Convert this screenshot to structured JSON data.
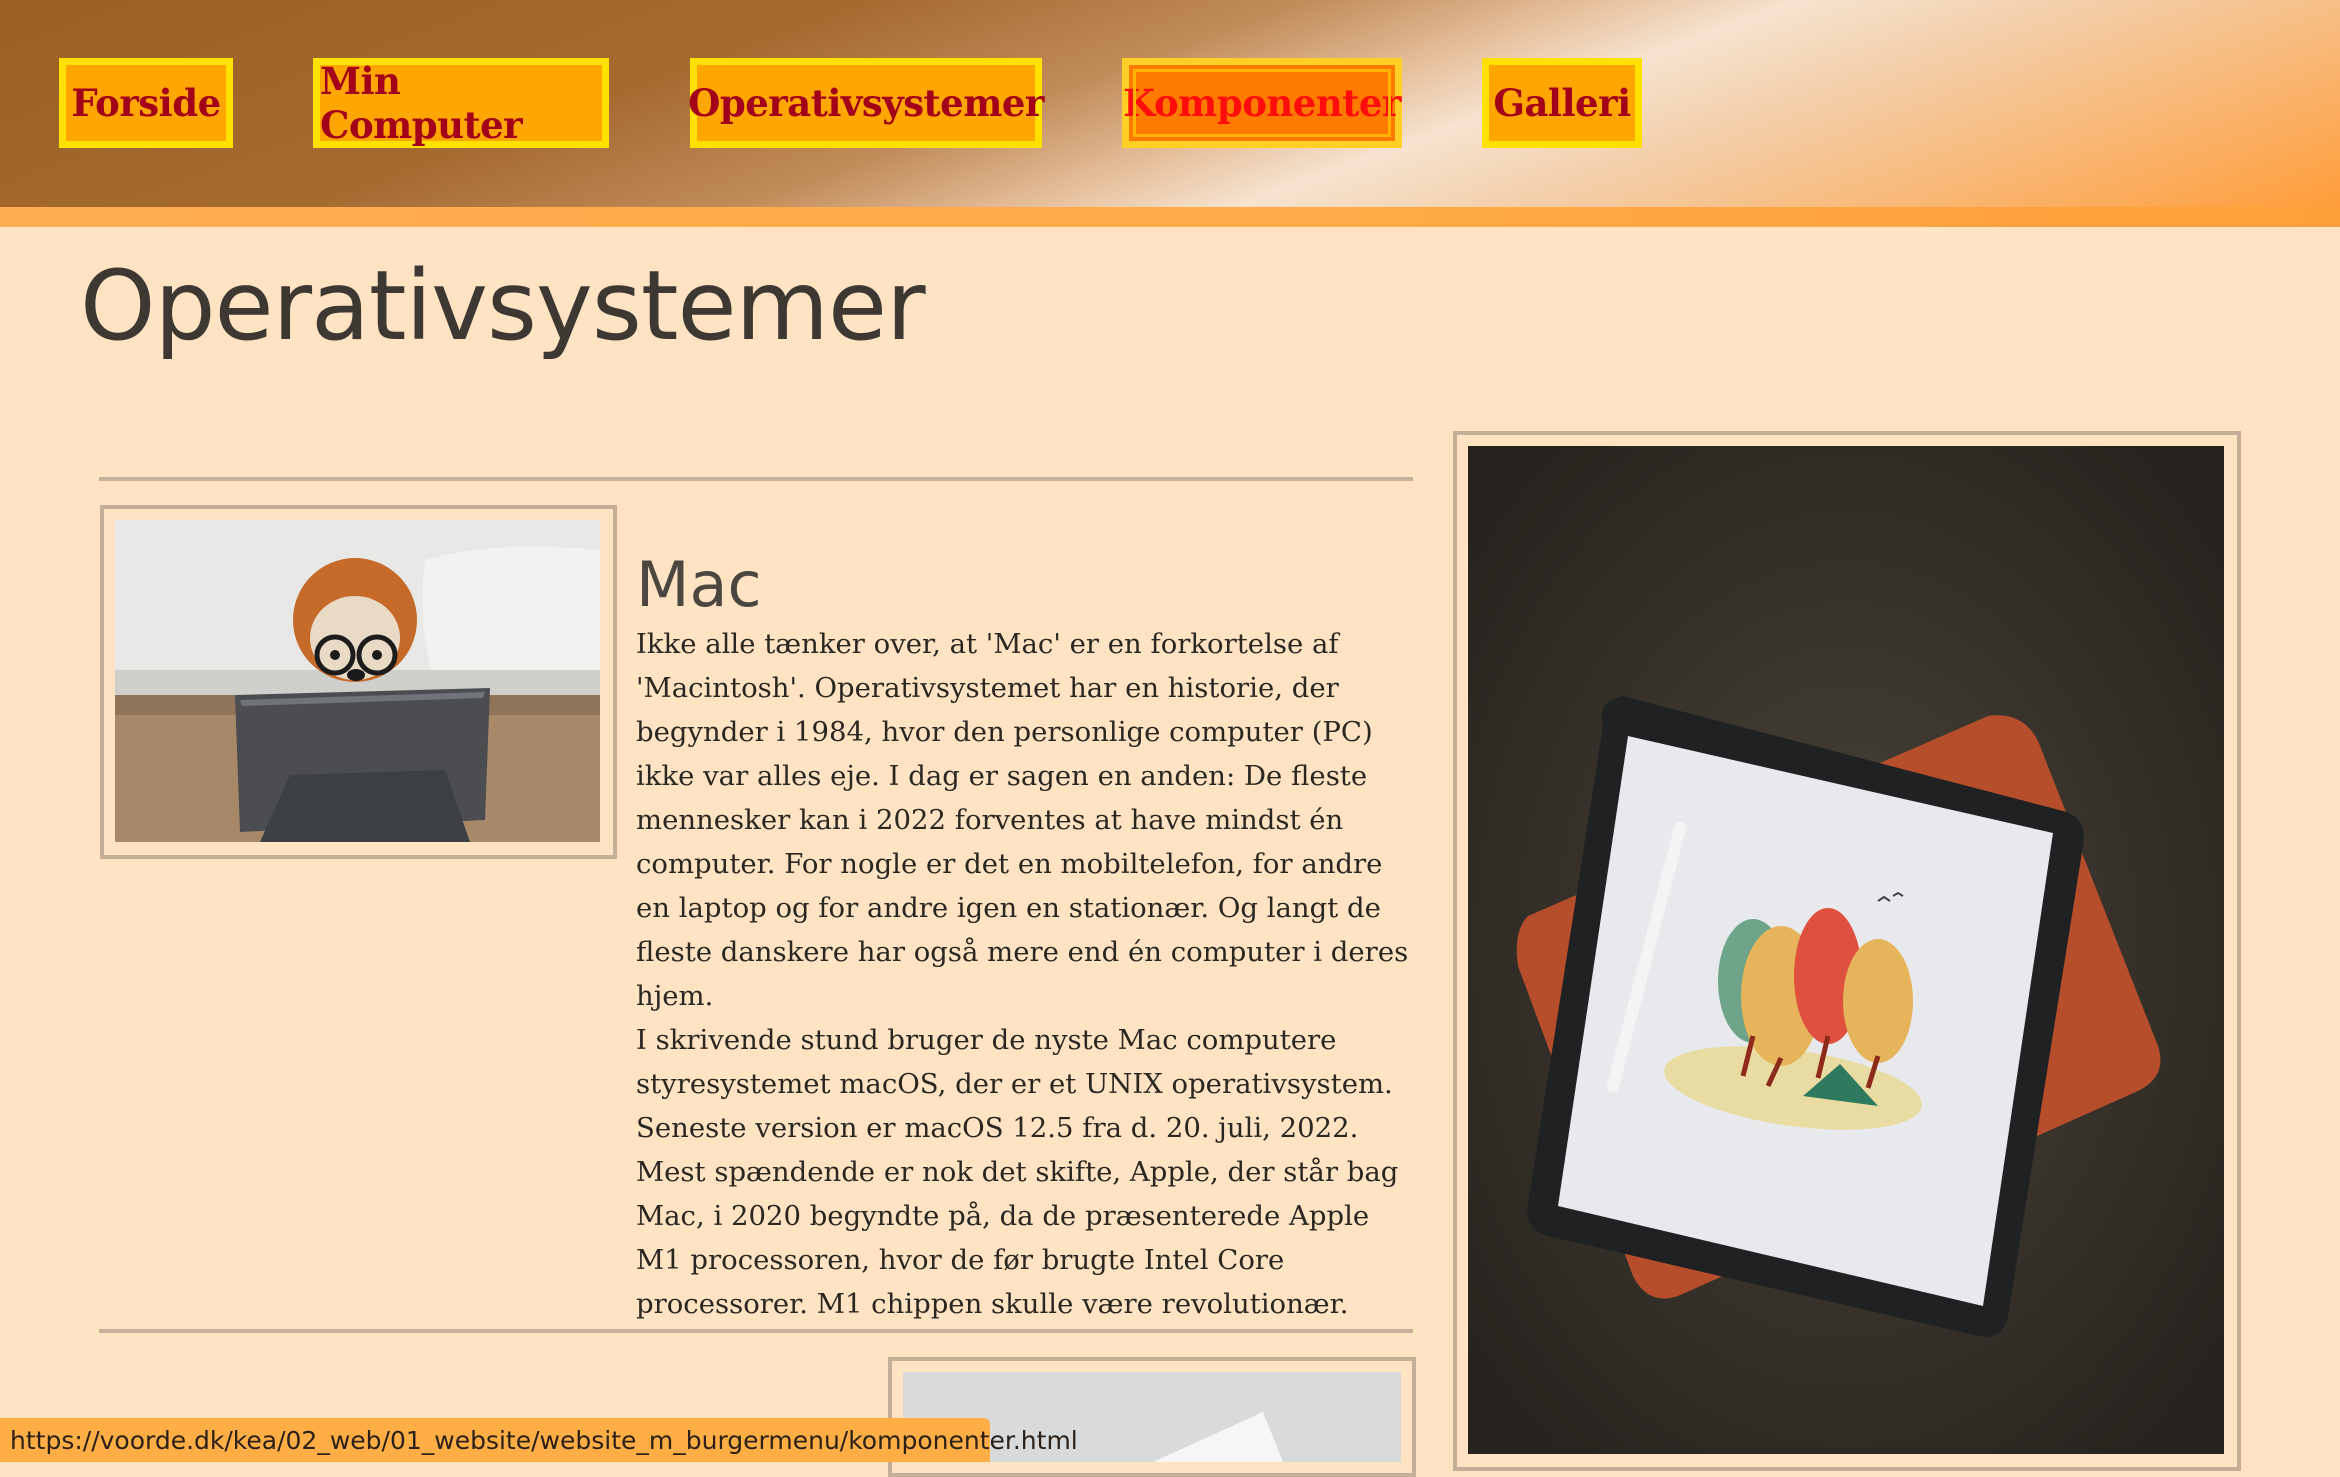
{
  "nav": {
    "items": [
      {
        "label": "Forside"
      },
      {
        "label": "Min Computer"
      },
      {
        "label": "Operativsystemer"
      },
      {
        "label": "Komponenter"
      },
      {
        "label": "Galleri"
      }
    ],
    "hovered": "Komponenter"
  },
  "page": {
    "title": "Operativsystemer"
  },
  "sections": [
    {
      "title": "Mac",
      "paragraphs": [
        "Ikke alle tænker over, at 'Mac' er en forkortelse af 'Macintosh'. Operativsystemet har en historie, der begynder i 1984, hvor den personlige computer (PC) ikke var alles eje. I dag er sagen en anden: De fleste mennesker kan i 2022 forventes at have mindst én computer. For nogle er det en mobiltelefon, for andre en laptop og for andre igen en stationær. Og langt de fleste danskere har også mere end én computer i deres hjem.",
        "I skrivende stund bruger de nyste Mac computere styresystemet macOS, der er et UNIX operativsystem. Seneste version er macOS 12.5 fra d. 20. juli, 2022. Mest spændende er nok det skifte, Apple, der står bag Mac, i 2020 begyndte på, da de præsenterede Apple M1 processoren, hvor de før brugte Intel Core processorer. M1 chippen skulle være revolutionær."
      ]
    }
  ],
  "status_bar": {
    "url": "https://voorde.dk/kea/02_web/01_website/website_m_burgermenu/komponenter.html"
  },
  "colors": {
    "background": "#ffe3c3",
    "nav_bg": "#ffa600",
    "nav_border": "#ffe100",
    "nav_text": "#a3001a",
    "nav_active_text": "#ff0d0d"
  }
}
